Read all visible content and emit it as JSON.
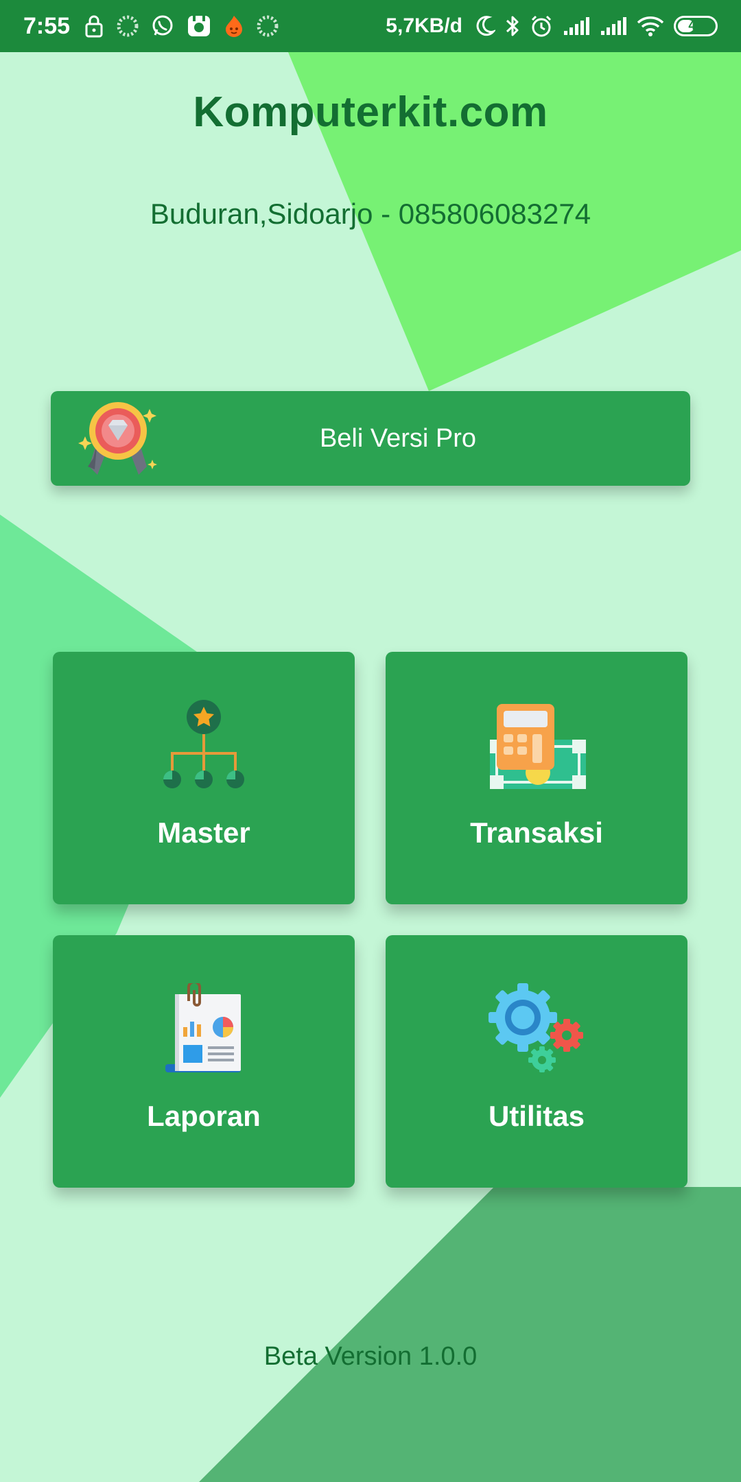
{
  "status_bar": {
    "time": "7:55",
    "network_speed": "5,7KB/d",
    "battery_level": "46",
    "battery_fraction": 0.46
  },
  "header": {
    "title": "Komputerkit.com",
    "subtitle": "Buduran,Sidoarjo - 085806083274"
  },
  "pro_button": {
    "label": "Beli Versi Pro",
    "icon": "diamond-medal-icon"
  },
  "menu": [
    {
      "label": "Master",
      "icon": "org-hierarchy-icon"
    },
    {
      "label": "Transaksi",
      "icon": "calculator-money-icon"
    },
    {
      "label": "Laporan",
      "icon": "report-document-icon"
    },
    {
      "label": "Utilitas",
      "icon": "gears-icon"
    }
  ],
  "footer": {
    "version": "Beta Version 1.0.0"
  },
  "colors": {
    "status_bar": "#1c8a3c",
    "background": "#c4f6d6",
    "card": "#2ba352",
    "text_dark_green": "#136e32"
  }
}
